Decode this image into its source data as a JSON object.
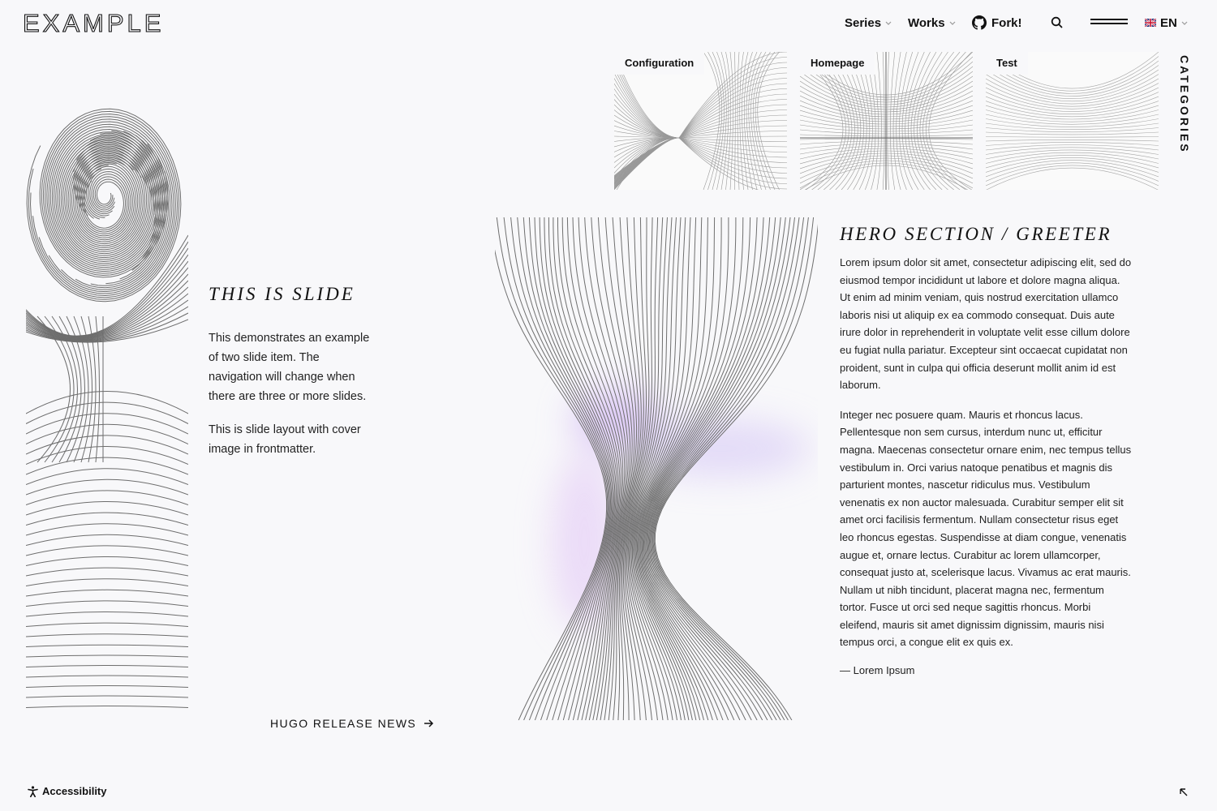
{
  "header": {
    "logo_text": "EXAMPLE",
    "nav": [
      {
        "label": "Series",
        "icon": "chevron-down-icon"
      },
      {
        "label": "Works",
        "icon": "chevron-down-icon"
      },
      {
        "label": "Fork!",
        "icon": "github-icon"
      }
    ],
    "search_icon": "search-icon",
    "menu_icon": "hamburger-menu-icon",
    "language": {
      "label": "EN",
      "icon": "uk-flag-icon"
    }
  },
  "categories": {
    "label": "CATEGORIES",
    "items": [
      {
        "label": "Configuration"
      },
      {
        "label": "Homepage"
      },
      {
        "label": "Test"
      }
    ]
  },
  "slide": {
    "title": "THIS IS SLIDE",
    "paragraphs": [
      "This demonstrates an exam­ple of two slide item. The navigation will change when there are three or more slides.",
      "This is slide layout with cover image in frontmatter."
    ],
    "link_label": "HUGO RELEASE NEWS",
    "link_icon": "arrow-right-icon"
  },
  "hero": {
    "title": "HERO SECTION / GREETER",
    "paragraphs": [
      "Lorem ipsum dolor sit amet, consectetur adipiscing elit, sed do eiusmod tempor incididunt ut labore et dolore magna aliqua. Ut enim ad minim veniam, quis nostrud exercitation ullamco laboris nisi ut aliquip ex ea commodo consequat. Duis aute irure dolor in reprehenderit in voluptate velit esse cillum dolore eu fugiat nulla pariatur. Excepteur sint occae­cat cupidatat non proident, sunt in culpa qui officia de­serunt mollit anim id est laborum.",
      "Integer nec posuere quam. Mauris et rhoncus lacus. Pellentesque non sem cursus, interdum nunc ut, efficitur magna. Maecenas consectetur ornare enim, nec tempus tellus vestibulum in. Orci varius natoque penatibus et mag­nis dis parturient montes, nascetur ridiculus mus. Vestibulum venenatis ex non auctor malesuada. Curabitur semper elit sit amet orci facilisis fermentum. Nullam con­sectetur risus eget leo rhoncus egestas. Suspendisse at diam congue, venenatis augue et, ornare lectus. Curabitur ac lorem ullamcorper, consequat justo at, scelerisque la­cus. Vivamus ac erat mauris. Nullam ut nibh tincidunt, plac­erat magna nec, fermentum tortor. Fusce ut orci sed neque sagittis rhoncus. Morbi eleifend, mauris sit amet dignissim dignissim, mauris nisi tempus orci, a congue elit ex quis ex."
    ],
    "signature": "— Lorem Ipsum"
  },
  "footer": {
    "accessibility_label": "Accessibility",
    "accessibility_icon": "accessibility-icon",
    "scroll_top_icon": "arrow-up-left-icon"
  },
  "colors": {
    "background": "#f8f8fa",
    "text": "#111111",
    "line_art": "#777777",
    "hero_glow": "#c7a6f2"
  }
}
